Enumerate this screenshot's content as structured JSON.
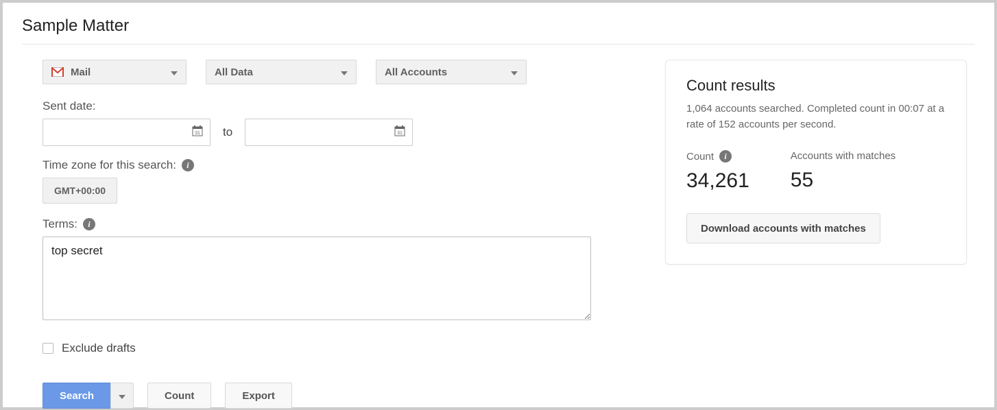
{
  "title": "Sample Matter",
  "filters": {
    "service": "Mail",
    "source": "All Data",
    "accounts": "All Accounts"
  },
  "sentDate": {
    "label": "Sent date:",
    "from": "",
    "to": "",
    "separator": "to"
  },
  "timezone": {
    "label": "Time zone for this search:",
    "value": "GMT+00:00"
  },
  "terms": {
    "label": "Terms:",
    "value": "top secret"
  },
  "excludeDrafts": {
    "label": "Exclude drafts",
    "checked": false
  },
  "buttons": {
    "search": "Search",
    "count": "Count",
    "export": "Export"
  },
  "results": {
    "heading": "Count results",
    "summary": "1,064 accounts searched. Completed count in 00:07 at a rate of 152 accounts per second.",
    "countLabel": "Count",
    "countValue": "34,261",
    "matchesLabel": "Accounts with matches",
    "matchesValue": "55",
    "download": "Download accounts with matches"
  }
}
